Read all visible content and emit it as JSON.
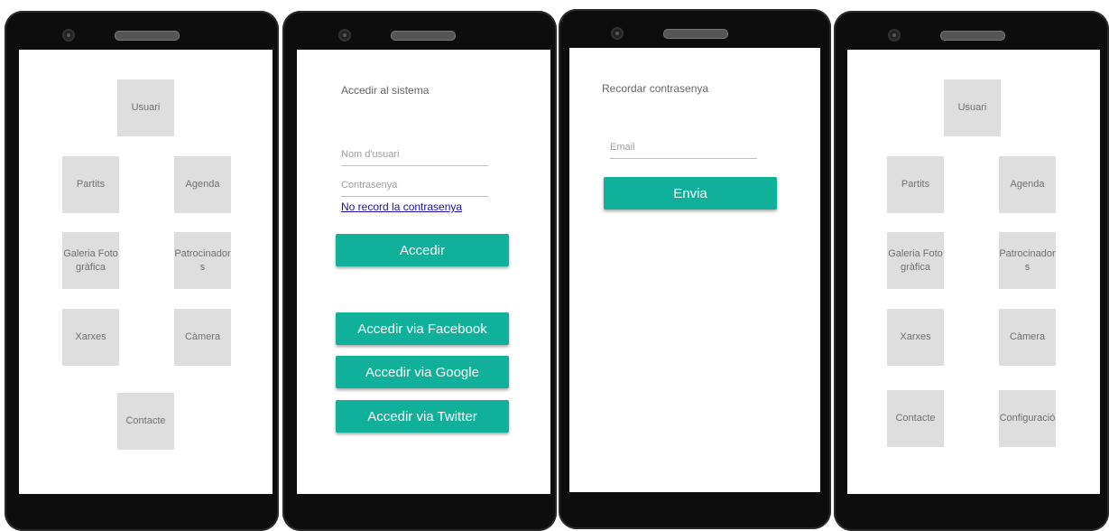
{
  "colors": {
    "accent": "#11b09b",
    "tile": "#dedede",
    "tile_text": "#6f6f6f",
    "link": "#1a0dab"
  },
  "screen1": {
    "tiles": [
      "Usuari",
      "Partits",
      "Agenda",
      "Galeria Fotogràfica",
      "Patrocinadors",
      "Xarxes",
      "Càmera",
      "Contacte"
    ]
  },
  "screen2": {
    "title": "Accedir al sistema",
    "username_placeholder": "Nom d'usuari",
    "password_placeholder": "Contrasenya",
    "forgot_link": "No record la contrasenya",
    "login_button": "Accedir",
    "facebook_button": "Accedir via Facebook",
    "google_button": "Accedir via Google",
    "twitter_button": "Accedir via Twitter"
  },
  "screen3": {
    "title": "Recordar contrasenya",
    "email_placeholder": "Email",
    "send_button": "Envia"
  },
  "screen4": {
    "tiles": [
      "Usuari",
      "Partits",
      "Agenda",
      "Galeria Fotogràfica",
      "Patrocinadors",
      "Xarxes",
      "Càmera",
      "Contacte",
      "Configuració"
    ]
  }
}
